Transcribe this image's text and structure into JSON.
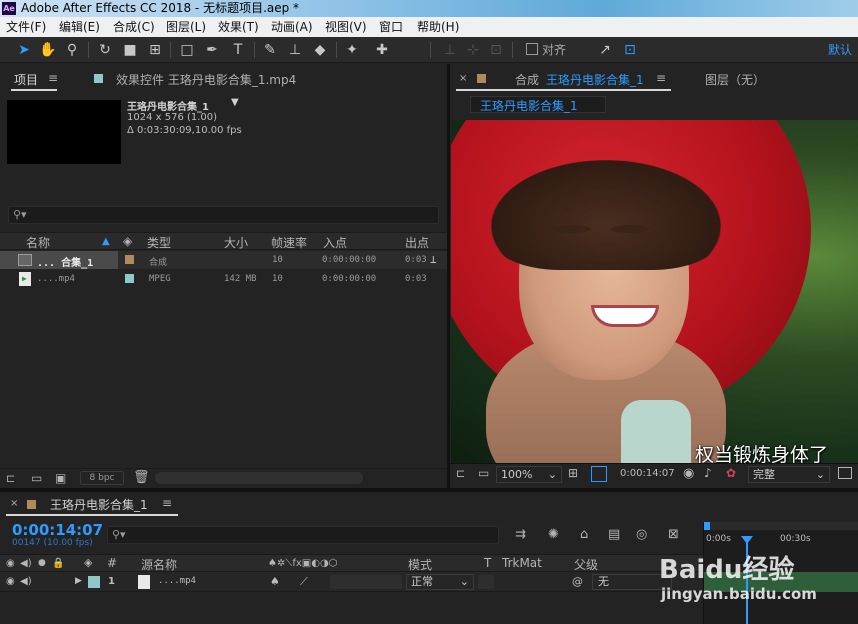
{
  "window": {
    "title": "Adobe After Effects CC 2018 - 无标题项目.aep *",
    "logo": "Ae"
  },
  "menu": [
    "文件(F)",
    "编辑(E)",
    "合成(C)",
    "图层(L)",
    "效果(T)",
    "动画(A)",
    "视图(V)",
    "窗口",
    "帮助(H)"
  ],
  "toolbar": {
    "snap_label": "对齐",
    "workspace": "默认"
  },
  "project": {
    "tab_project": "项目",
    "tab_effects": "效果控件 王珞丹电影合集_1.mp4",
    "selected_name": "王珞丹电影合集_1",
    "selected_dims": "1024 x 576 (1.00)",
    "selected_duration": "Δ 0:03:30:09,10.00 fps",
    "columns": [
      "名称",
      "类型",
      "大小",
      "帧速率",
      "入点",
      "出点"
    ],
    "items": [
      {
        "name": "... 合集_1",
        "type": "合成",
        "size": "",
        "fps": "10",
        "in": "0:00:00:00",
        "out": "0:03",
        "color": "#b08a5a"
      },
      {
        "name": "....mp4",
        "type": "MPEG",
        "size": "142 MB",
        "fps": "10",
        "in": "0:00:00:00",
        "out": "0:03",
        "color": "#8fc8c8"
      }
    ],
    "bpc": "8 bpc"
  },
  "composition": {
    "tab_label": "合成",
    "tab_name": "王珞丹电影合集_1",
    "layer_tab": "图层（无）",
    "breadcrumb": "王珞丹电影合集_1",
    "subtitle": "权当锻炼身体了",
    "zoom": "100%",
    "time": "0:00:14:07",
    "resolution": "完整"
  },
  "timeline": {
    "tab_name": "王珞丹电影合集_1",
    "timecode": "0:00:14:07",
    "frames": "00147 (10.00 fps)",
    "columns": {
      "index": "#",
      "source": "源名称",
      "mode": "模式",
      "t": "T",
      "trkmat": "TrkMat",
      "parent": "父级"
    },
    "layer": {
      "index": "1",
      "name": "....mp4",
      "mode": "正常",
      "parent": "无"
    },
    "ruler_start": "0:00s",
    "ruler_mark": "00:30s"
  },
  "watermark": {
    "brand": "Baidu经验",
    "url": "jingyan.baidu.com"
  }
}
